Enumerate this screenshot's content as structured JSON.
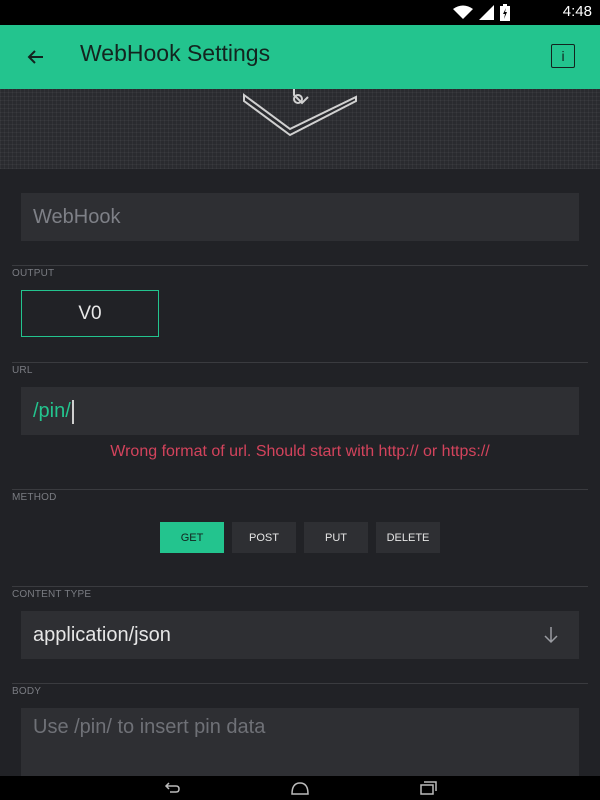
{
  "status_bar": {
    "time": "4:48",
    "icons": [
      "wifi-icon",
      "signal-icon",
      "battery-icon"
    ]
  },
  "app_bar": {
    "title": "WebHook Settings",
    "back_icon": "arrow-left-icon",
    "info_label": "i"
  },
  "widget_name": {
    "value": "WebHook"
  },
  "output": {
    "label": "OUTPUT",
    "pin": "V0"
  },
  "url": {
    "label": "URL",
    "value": "/pin/",
    "error": "Wrong format of url. Should start with http:// or https://"
  },
  "method": {
    "label": "METHOD",
    "options": [
      {
        "label": "GET",
        "active": true
      },
      {
        "label": "POST",
        "active": false
      },
      {
        "label": "PUT",
        "active": false
      },
      {
        "label": "DELETE",
        "active": false
      }
    ]
  },
  "content_type": {
    "label": "CONTENT TYPE",
    "value": "application/json",
    "icon": "arrow-down-icon"
  },
  "body": {
    "label": "BODY",
    "placeholder": "Use /pin/ to insert pin data"
  },
  "nav_bar": {
    "icons": [
      "back-nav-icon",
      "home-nav-icon",
      "recents-nav-icon"
    ]
  },
  "colors": {
    "accent": "#23c48e",
    "background": "#212226",
    "field": "#2e2f33",
    "error": "#d3435c"
  }
}
